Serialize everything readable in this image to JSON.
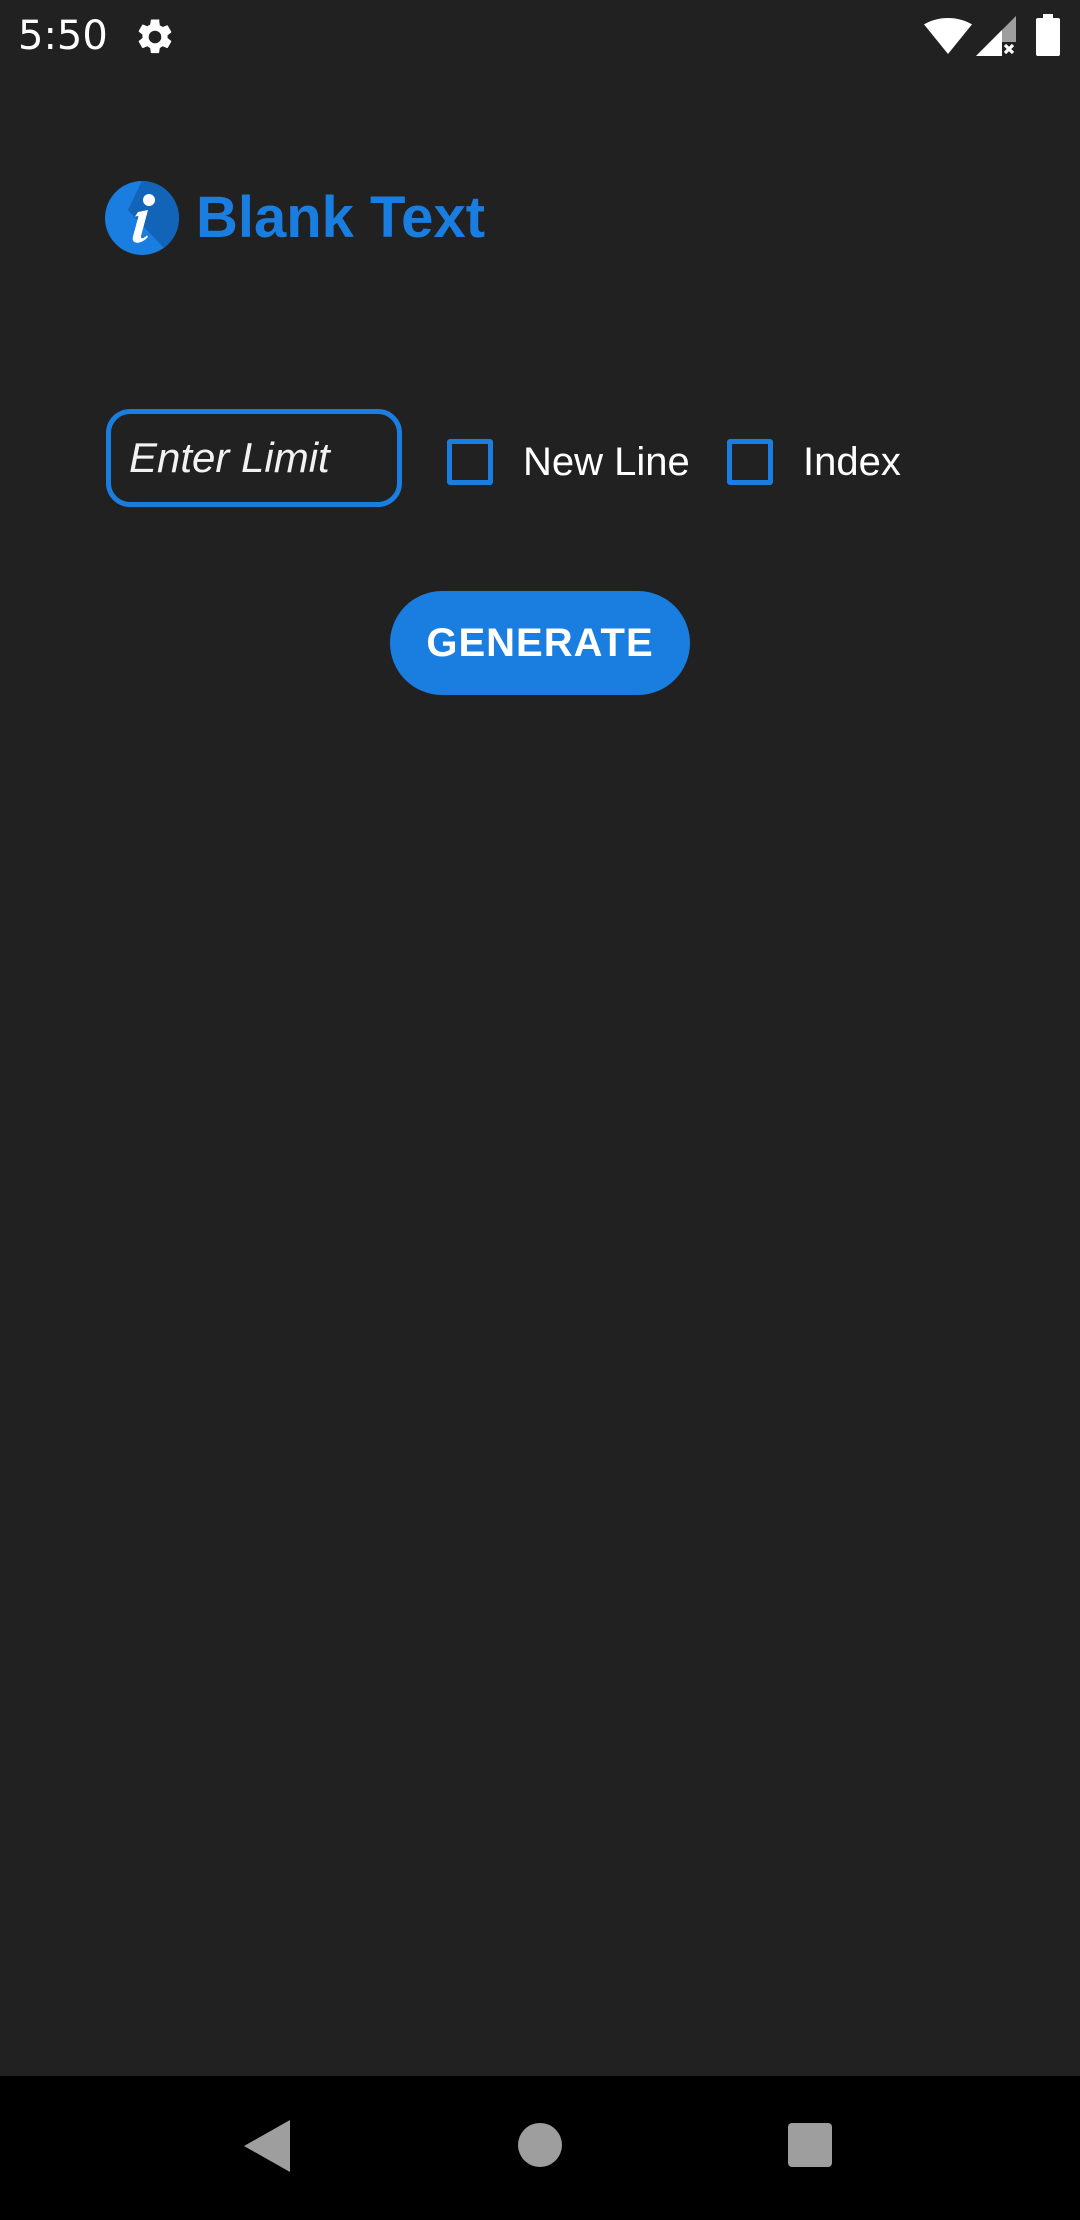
{
  "status_bar": {
    "time": "5:50",
    "icons": [
      "gear-icon",
      "wifi-icon",
      "signal-icon",
      "battery-icon"
    ]
  },
  "app": {
    "title": "Blank Text",
    "logo_icon": "info-icon"
  },
  "controls": {
    "limit_placeholder": "Enter Limit",
    "limit_value": "",
    "new_line_label": "New Line",
    "new_line_checked": false,
    "index_label": "Index",
    "index_checked": false
  },
  "generate_label": "GENERATE",
  "nav": {
    "icons": [
      "back-icon",
      "home-icon",
      "recents-icon"
    ]
  },
  "colors": {
    "accent": "#1a7de0",
    "background": "#212121",
    "nav_background": "#000000"
  }
}
